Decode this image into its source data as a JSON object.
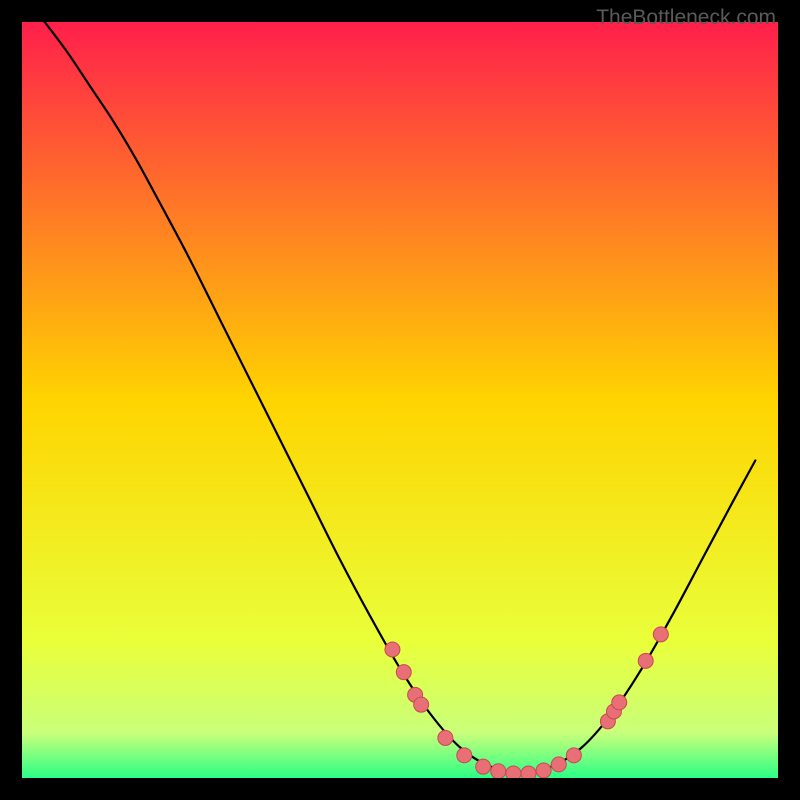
{
  "watermark": "TheBottleneck.com",
  "chart_data": {
    "type": "line",
    "title": "",
    "xlabel": "",
    "ylabel": "",
    "xlim": [
      0,
      100
    ],
    "ylim": [
      0,
      100
    ],
    "background_gradient": {
      "stops": [
        {
          "offset": 0,
          "color": "#ff1f4b"
        },
        {
          "offset": 50,
          "color": "#ffd400"
        },
        {
          "offset": 82,
          "color": "#e9ff3a"
        },
        {
          "offset": 94,
          "color": "#c9ff7a"
        },
        {
          "offset": 100,
          "color": "#2bff86"
        }
      ]
    },
    "curve": [
      {
        "x": 3.0,
        "y": 100.0
      },
      {
        "x": 6.0,
        "y": 96.0
      },
      {
        "x": 9.0,
        "y": 91.5
      },
      {
        "x": 12.0,
        "y": 87.0
      },
      {
        "x": 15.0,
        "y": 82.0
      },
      {
        "x": 18.0,
        "y": 76.5
      },
      {
        "x": 22.0,
        "y": 69.0
      },
      {
        "x": 26.0,
        "y": 61.0
      },
      {
        "x": 30.0,
        "y": 53.0
      },
      {
        "x": 34.0,
        "y": 45.0
      },
      {
        "x": 38.0,
        "y": 37.0
      },
      {
        "x": 42.0,
        "y": 29.0
      },
      {
        "x": 46.0,
        "y": 21.5
      },
      {
        "x": 50.0,
        "y": 14.5
      },
      {
        "x": 54.0,
        "y": 8.5
      },
      {
        "x": 58.0,
        "y": 4.0
      },
      {
        "x": 62.0,
        "y": 1.5
      },
      {
        "x": 66.0,
        "y": 0.7
      },
      {
        "x": 70.0,
        "y": 1.5
      },
      {
        "x": 74.0,
        "y": 4.0
      },
      {
        "x": 78.0,
        "y": 8.5
      },
      {
        "x": 82.0,
        "y": 14.5
      },
      {
        "x": 86.0,
        "y": 21.5
      },
      {
        "x": 90.0,
        "y": 29.0
      },
      {
        "x": 94.0,
        "y": 36.5
      },
      {
        "x": 97.0,
        "y": 42.0
      }
    ],
    "markers": [
      {
        "x": 49.0,
        "y": 17.0
      },
      {
        "x": 50.5,
        "y": 14.0
      },
      {
        "x": 52.0,
        "y": 11.0
      },
      {
        "x": 52.8,
        "y": 9.7
      },
      {
        "x": 56.0,
        "y": 5.3
      },
      {
        "x": 58.5,
        "y": 3.0
      },
      {
        "x": 61.0,
        "y": 1.5
      },
      {
        "x": 63.0,
        "y": 0.9
      },
      {
        "x": 65.0,
        "y": 0.6
      },
      {
        "x": 67.0,
        "y": 0.6
      },
      {
        "x": 69.0,
        "y": 1.0
      },
      {
        "x": 71.0,
        "y": 1.8
      },
      {
        "x": 73.0,
        "y": 3.0
      },
      {
        "x": 77.5,
        "y": 7.5
      },
      {
        "x": 78.3,
        "y": 8.8
      },
      {
        "x": 79.0,
        "y": 10.0
      },
      {
        "x": 82.5,
        "y": 15.5
      },
      {
        "x": 84.5,
        "y": 19.0
      }
    ],
    "marker_style": {
      "fill": "#e86f76",
      "stroke": "#c74a52",
      "radius": 7.5
    },
    "curve_style": {
      "stroke": "#000000",
      "width": 2.2
    }
  }
}
